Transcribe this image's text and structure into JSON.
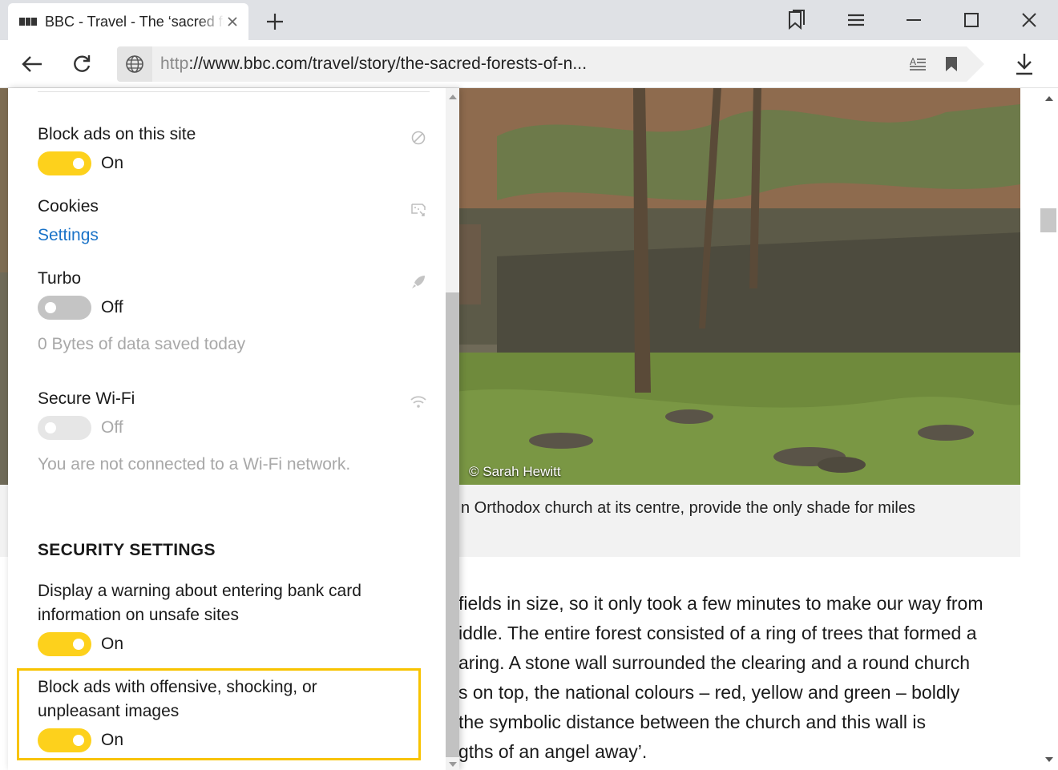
{
  "tab": {
    "title": "BBC - Travel - The ‘sacred forests’"
  },
  "toolbar": {
    "url_scheme": "http",
    "url_rest": "://www.bbc.com/travel/story/the-sacred-forests-of-n..."
  },
  "page": {
    "photo_credit": "© Sarah Hewitt",
    "caption": "n Orthodox church at its centre, provide the only shade for miles",
    "article_lines": [
      " fields in size, so it only took a few minutes to make our way from",
      "iddle. The entire forest consisted of a ring of trees that formed a",
      "aring. A stone wall surrounded the clearing and a round church",
      "s on top, the national colours – red, yellow and green – boldly",
      "the symbolic distance between the church and this wall is",
      "gths of an angel away’."
    ]
  },
  "panel": {
    "block_ads_site": {
      "label": "Block ads on this site",
      "state": "On"
    },
    "cookies": {
      "label": "Cookies",
      "link": "Settings"
    },
    "turbo": {
      "label": "Turbo",
      "state": "Off",
      "hint": "0 Bytes of data saved today"
    },
    "secure_wifi": {
      "label": "Secure Wi-Fi",
      "state": "Off",
      "hint": "You are not connected to a Wi-Fi network."
    },
    "security_heading": "SECURITY SETTINGS",
    "bank_card": {
      "label_line1": "Display a warning about entering bank card",
      "label_line2": "information on unsafe sites",
      "state": "On"
    },
    "offensive_ads": {
      "label_line1": "Block ads with offensive, shocking, or",
      "label_line2": "unpleasant images",
      "state": "On"
    }
  },
  "colors": {
    "toggle_on": "#fdd11c",
    "highlight_border": "#f8c300",
    "link": "#1a73c8"
  }
}
